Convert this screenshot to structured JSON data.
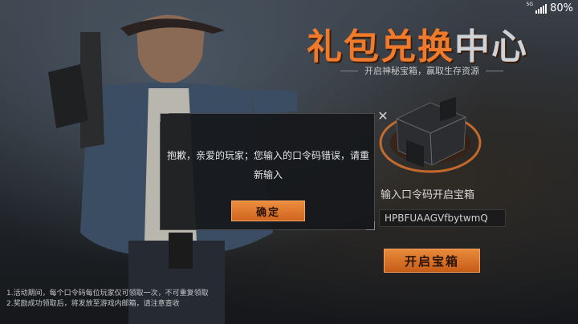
{
  "status_bar": {
    "battery": "80%",
    "network": "5G"
  },
  "header": {
    "title_part1": "礼包兑换",
    "title_part2": "中心",
    "subtitle": "开启神秘宝箱，赢取生存资源"
  },
  "redeem": {
    "label": "输入口令码开启宝箱",
    "code_value": "HPBFUAAGVfbytwmQ",
    "open_button": "开启宝箱"
  },
  "notes": [
    "1.活动期间，每个口令码每位玩家仅可领取一次，不可重复领取",
    "2.奖励成功领取后，将发放至游戏内邮箱，请注意查收"
  ],
  "dialog": {
    "message": "抱歉，亲爱的玩家；您输入的口令码错误，请重新输入",
    "confirm": "确定"
  },
  "colors": {
    "accent": "#e8782c",
    "dialog_bg": "#16181b"
  },
  "icons": {
    "close": "close-icon",
    "chest": "chest-icon",
    "signal": "signal-icon"
  }
}
